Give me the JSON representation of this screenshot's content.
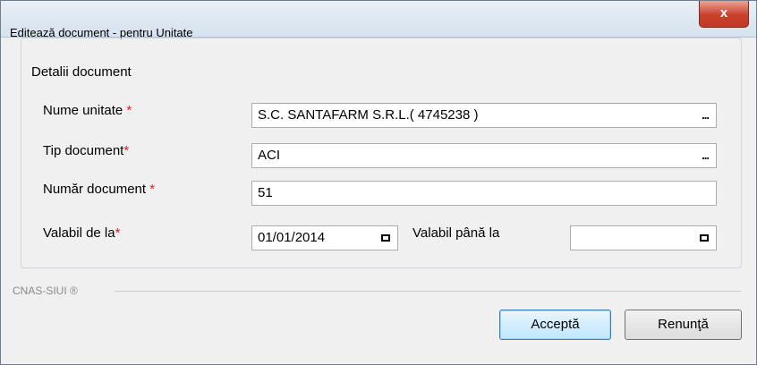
{
  "window": {
    "title": "Editează document - pentru Unitate",
    "close_label": "x"
  },
  "group": {
    "title": "Detalii document"
  },
  "fields": {
    "nume_unitate": {
      "label": "Nume unitate ",
      "required": "*",
      "value": "S.C. SANTAFARM S.R.L.( 4745238 )",
      "button": "..."
    },
    "tip_document": {
      "label": "Tip document",
      "required": "*",
      "value": "ACI",
      "button": "..."
    },
    "numar_document": {
      "label": "Număr document ",
      "required": "*",
      "value": "51"
    },
    "valabil_de_la": {
      "label": "Valabil de la",
      "required": "*",
      "value": "01/01/2014"
    },
    "valabil_pana_la": {
      "label": "Valabil până la",
      "value": ""
    }
  },
  "footer": {
    "brand": "CNAS-SIUI ®"
  },
  "buttons": {
    "accept": "Acceptă",
    "cancel": "Renunţă"
  }
}
